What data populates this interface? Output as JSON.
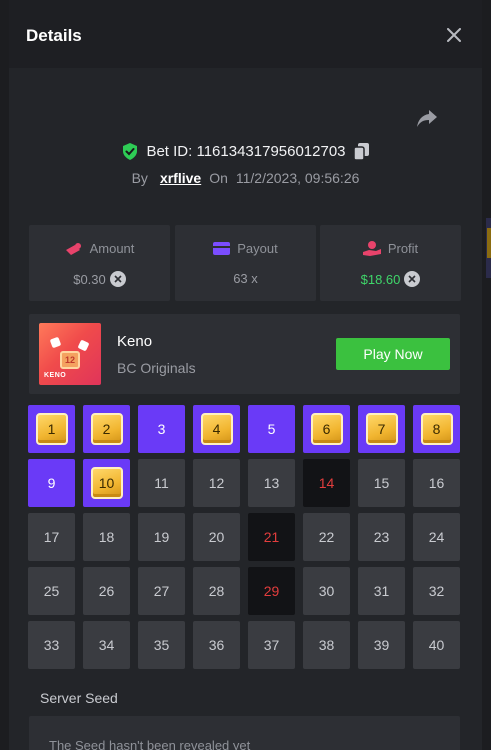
{
  "modal": {
    "title": "Details"
  },
  "bet": {
    "id_text": "Bet ID: 116134317956012703",
    "by_label": "By",
    "username": "xrflive",
    "on_label": "On",
    "datetime": "11/2/2023, 09:56:26"
  },
  "stats": {
    "amount": {
      "label": "Amount",
      "value": "$0.30"
    },
    "payout": {
      "label": "Payout",
      "value": "63 x"
    },
    "profit": {
      "label": "Profit",
      "value": "$18.60"
    }
  },
  "game": {
    "name": "Keno",
    "provider": "BC Originals",
    "play_label": "Play Now",
    "thumb_number": "12",
    "thumb_label": "KENO"
  },
  "keno": {
    "cells": [
      {
        "n": "1",
        "state": "hit"
      },
      {
        "n": "2",
        "state": "hit"
      },
      {
        "n": "3",
        "state": "selected"
      },
      {
        "n": "4",
        "state": "hit"
      },
      {
        "n": "5",
        "state": "selected"
      },
      {
        "n": "6",
        "state": "hit"
      },
      {
        "n": "7",
        "state": "hit"
      },
      {
        "n": "8",
        "state": "hit"
      },
      {
        "n": "9",
        "state": "selected"
      },
      {
        "n": "10",
        "state": "hit"
      },
      {
        "n": "11",
        "state": "none"
      },
      {
        "n": "12",
        "state": "none"
      },
      {
        "n": "13",
        "state": "none"
      },
      {
        "n": "14",
        "state": "drawn"
      },
      {
        "n": "15",
        "state": "none"
      },
      {
        "n": "16",
        "state": "none"
      },
      {
        "n": "17",
        "state": "none"
      },
      {
        "n": "18",
        "state": "none"
      },
      {
        "n": "19",
        "state": "none"
      },
      {
        "n": "20",
        "state": "none"
      },
      {
        "n": "21",
        "state": "drawn"
      },
      {
        "n": "22",
        "state": "none"
      },
      {
        "n": "23",
        "state": "none"
      },
      {
        "n": "24",
        "state": "none"
      },
      {
        "n": "25",
        "state": "none"
      },
      {
        "n": "26",
        "state": "none"
      },
      {
        "n": "27",
        "state": "none"
      },
      {
        "n": "28",
        "state": "none"
      },
      {
        "n": "29",
        "state": "drawn"
      },
      {
        "n": "30",
        "state": "none"
      },
      {
        "n": "31",
        "state": "none"
      },
      {
        "n": "32",
        "state": "none"
      },
      {
        "n": "33",
        "state": "none"
      },
      {
        "n": "34",
        "state": "none"
      },
      {
        "n": "35",
        "state": "none"
      },
      {
        "n": "36",
        "state": "none"
      },
      {
        "n": "37",
        "state": "none"
      },
      {
        "n": "38",
        "state": "none"
      },
      {
        "n": "39",
        "state": "none"
      },
      {
        "n": "40",
        "state": "none"
      }
    ]
  },
  "seed": {
    "title": "Server Seed",
    "message": "The Seed hasn't been revealed yet"
  },
  "colors": {
    "accent_purple": "#6a3af7",
    "play_green": "#3bc13f",
    "profit_green": "#3fd66a",
    "miss_red": "#e23d3d",
    "shield_green": "#2ecc55",
    "amount_icon": "#e8436b",
    "payout_icon": "#7b4dff",
    "profit_icon": "#e8436b"
  },
  "icons": {
    "close": "close-icon",
    "share": "share-icon",
    "verified": "shield-check-icon",
    "copy": "copy-icon",
    "amount": "coins-icon",
    "payout": "wallet-icon",
    "profit": "hand-coin-icon",
    "remove": "x-circle-icon"
  }
}
